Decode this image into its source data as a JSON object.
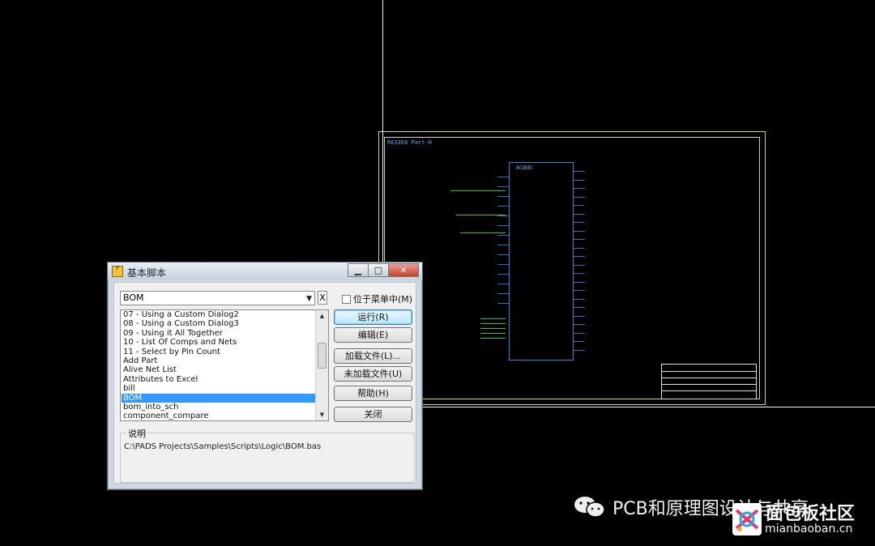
{
  "schematic": {
    "sheet_title": "RK3368 Part-H",
    "chip_name": "ACODEC"
  },
  "dialog": {
    "title": "基本脚本",
    "script_select_value": "BOM",
    "clear_button": "X",
    "in_menu_checkbox_label": "位于菜单中(M)",
    "in_menu_checked": false,
    "script_list": [
      "07 - Using a Custom Dialog2",
      "08 - Using a Custom Dialog3",
      "09 - Using it All Together",
      "10 - List Of Comps and Nets",
      "11 - Select by Pin Count",
      "Add Part",
      "Alive Net List",
      "Attributes to Excel",
      "bill",
      "BOM",
      "bom_into_sch",
      "component_compare"
    ],
    "selected_index": 9,
    "buttons": {
      "run": "运行(R)",
      "edit": "编辑(E)",
      "load_file": "加载文件(L)...",
      "unload_file": "未加载文件(U)",
      "help": "帮助(H)",
      "close": "关闭"
    },
    "description_label": "说明",
    "description_text": "C:\\PADS Projects\\Samples\\Scripts\\Logic\\BOM.bas"
  },
  "watermark": {
    "text": "PCB和原理图设计与共享",
    "logo_cn": "面包板社区",
    "logo_url": "mianbaoban.cn"
  }
}
